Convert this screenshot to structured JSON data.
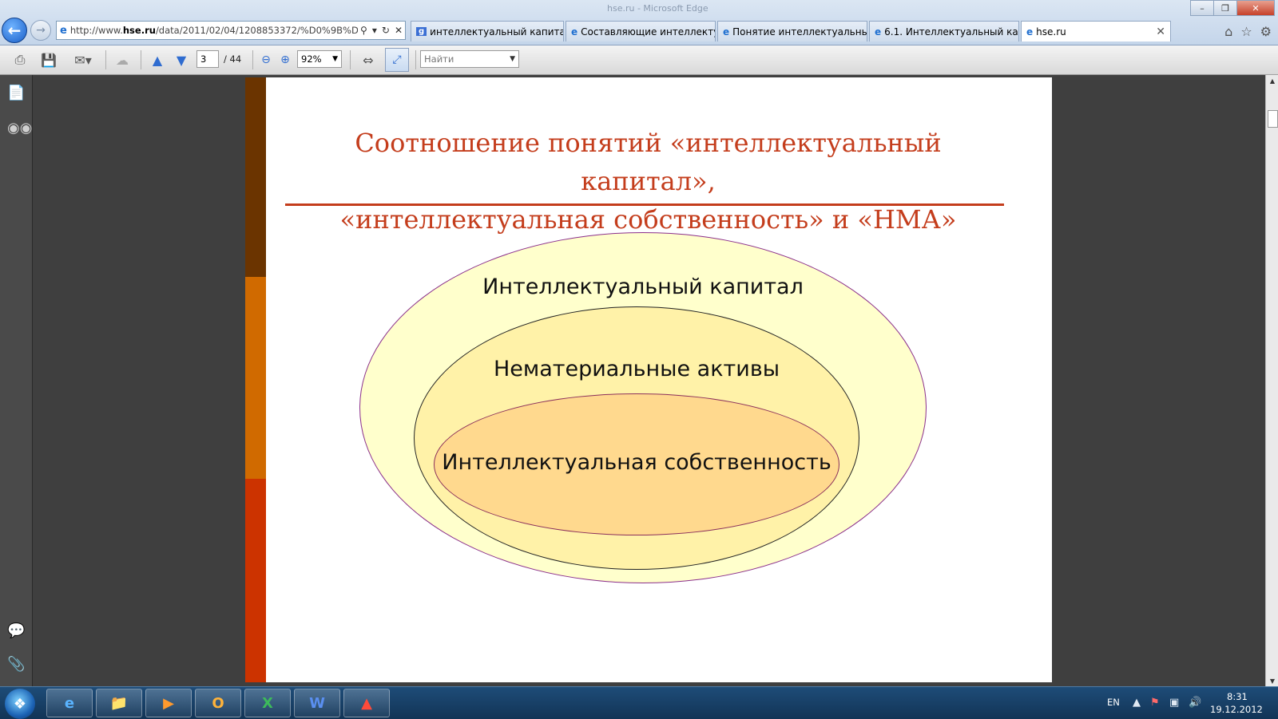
{
  "browser": {
    "title_ghost": "hse.ru - Microsoft Edge",
    "address": {
      "prefix": "http://www.",
      "domain": "hse.ru",
      "path": "/data/2011/02/04/1208853372/%D0%9B%D0%E"
    },
    "tabs": [
      {
        "label": "интеллектуальный капитал ...",
        "icon": "google-icon",
        "active": false
      },
      {
        "label": "Составляющие интеллектуа...",
        "icon": "ie-icon",
        "active": false
      },
      {
        "label": "Понятие интеллектуальный ...",
        "icon": "ie-icon",
        "active": false
      },
      {
        "label": "6.1. Интеллектуальный капи...",
        "icon": "ie-icon",
        "active": false
      },
      {
        "label": "hse.ru",
        "icon": "ie-icon",
        "active": true
      }
    ]
  },
  "pdf_toolbar": {
    "page_current": "3",
    "page_total": "/ 44",
    "zoom": "92%",
    "search_placeholder": "Найти"
  },
  "slide": {
    "title_line1": "Соотношение понятий «интеллектуальный капитал»,",
    "title_line2": "«интеллектуальная собственность» и «НМА»",
    "outer_label": "Интеллектуальный капитал",
    "middle_label": "Нематериальные активы",
    "inner_label": "Интеллектуальная собственность",
    "colors": {
      "title": "#c43d1c",
      "outer_fill": "#ffffcc",
      "middle_fill": "#fff2a8",
      "inner_fill": "#ffd98e",
      "band_top": "#6b3400",
      "band_mid": "#d06a00",
      "band_bottom": "#cc3300"
    }
  },
  "taskbar": {
    "lang": "EN",
    "time": "8:31",
    "date": "19.12.2012"
  }
}
